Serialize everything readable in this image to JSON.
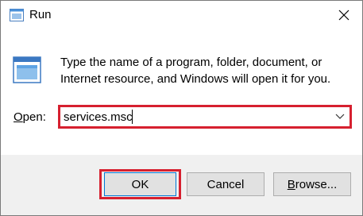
{
  "window": {
    "title": "Run",
    "icon": "run-dialog-icon",
    "close_icon": "close-icon"
  },
  "content": {
    "program_icon": "program-window-icon",
    "description": "Type the name of a program, folder, document, or Internet resource, and Windows will open it for you.",
    "open_label_underlined": "O",
    "open_label_rest": "pen:",
    "input_value": "services.msc",
    "dropdown_icon": "chevron-down-icon"
  },
  "buttons": {
    "ok": "OK",
    "cancel": "Cancel",
    "browse_underlined": "B",
    "browse_rest": "rowse..."
  },
  "colors": {
    "highlight": "#d6202f",
    "button_bg": "#e1e1e1",
    "footer_bg": "#f0f0f0",
    "focus_border": "#0078d7"
  }
}
